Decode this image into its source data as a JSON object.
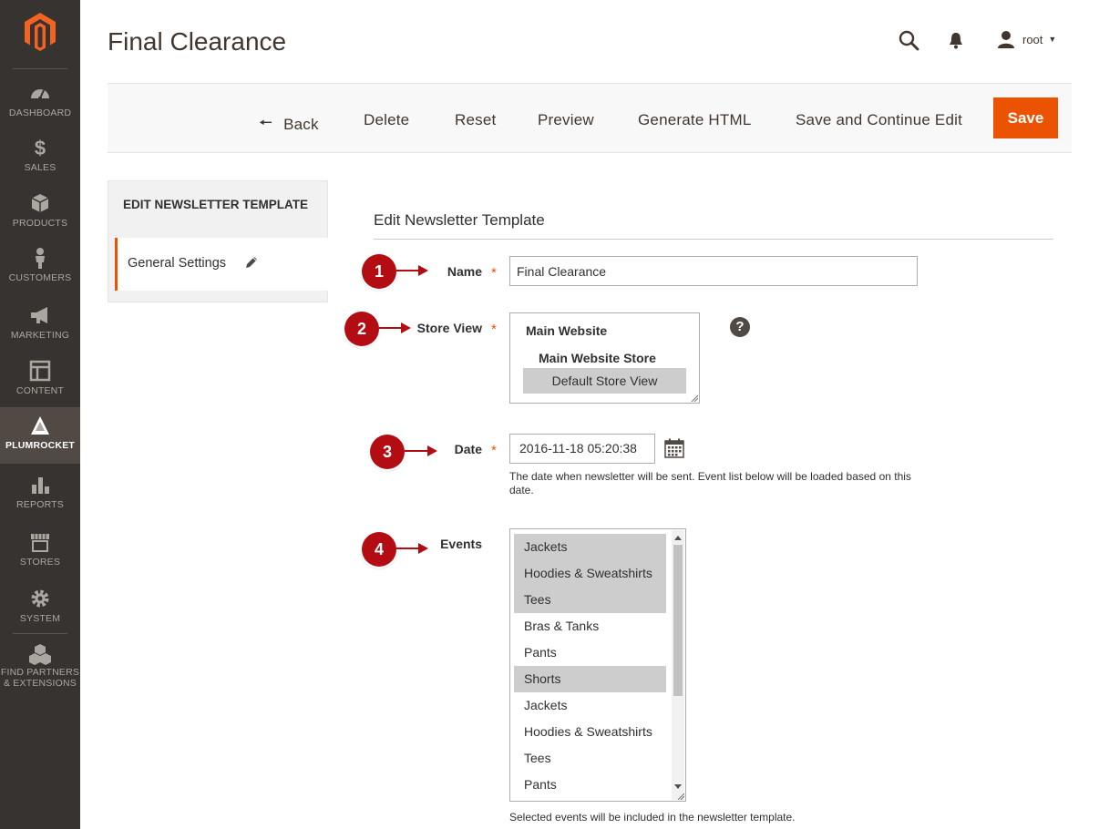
{
  "sidebar": {
    "logo_icon": "magento-logo-icon",
    "items": [
      {
        "label": "DASHBOARD",
        "icon": "dashboard-icon"
      },
      {
        "label": "SALES",
        "icon": "dollar-icon"
      },
      {
        "label": "PRODUCTS",
        "icon": "box-icon"
      },
      {
        "label": "CUSTOMERS",
        "icon": "person-icon"
      },
      {
        "label": "MARKETING",
        "icon": "megaphone-icon"
      },
      {
        "label": "CONTENT",
        "icon": "layout-icon"
      },
      {
        "label": "PLUMROCKET",
        "icon": "plumrocket-icon",
        "active": true
      },
      {
        "label": "REPORTS",
        "icon": "bar-chart-icon"
      },
      {
        "label": "STORES",
        "icon": "store-icon"
      },
      {
        "label": "SYSTEM",
        "icon": "gear-icon"
      },
      {
        "label": "FIND PARTNERS & EXTENSIONS",
        "icon": "cubes-icon"
      }
    ]
  },
  "header": {
    "title": "Final Clearance",
    "user": "root"
  },
  "toolbar": {
    "back": "Back",
    "delete": "Delete",
    "reset": "Reset",
    "preview": "Preview",
    "generate_html": "Generate HTML",
    "save_continue": "Save and Continue Edit",
    "save": "Save"
  },
  "tabs": {
    "title": "EDIT NEWSLETTER TEMPLATE",
    "items": [
      {
        "label": "General Settings"
      }
    ]
  },
  "form": {
    "section_title": "Edit Newsletter Template",
    "name": {
      "label": "Name",
      "value": "Final Clearance",
      "callout": "1"
    },
    "store_view": {
      "label": "Store View",
      "callout": "2",
      "website": "Main Website",
      "store": "Main Website Store",
      "view": "Default Store View",
      "help": "?"
    },
    "date": {
      "label": "Date",
      "value": "2016-11-18 05:20:38",
      "callout": "3",
      "note": "The date when newsletter will be sent. Event list below will be loaded based on this date."
    },
    "events": {
      "label": "Events",
      "callout": "4",
      "options": [
        {
          "label": "Jackets",
          "selected": true
        },
        {
          "label": "Hoodies & Sweatshirts",
          "selected": true
        },
        {
          "label": "Tees",
          "selected": true
        },
        {
          "label": "Bras & Tanks",
          "selected": false
        },
        {
          "label": "Pants",
          "selected": false
        },
        {
          "label": "Shorts",
          "selected": true
        },
        {
          "label": "Jackets",
          "selected": false
        },
        {
          "label": "Hoodies & Sweatshirts",
          "selected": false
        },
        {
          "label": "Tees",
          "selected": false
        },
        {
          "label": "Pants",
          "selected": false
        }
      ],
      "note": "Selected events will be included in the newsletter template."
    },
    "required_mark": "*"
  },
  "colors": {
    "accent": "#eb5202",
    "sidebar_bg": "#373330",
    "callout": "#b30c12"
  }
}
